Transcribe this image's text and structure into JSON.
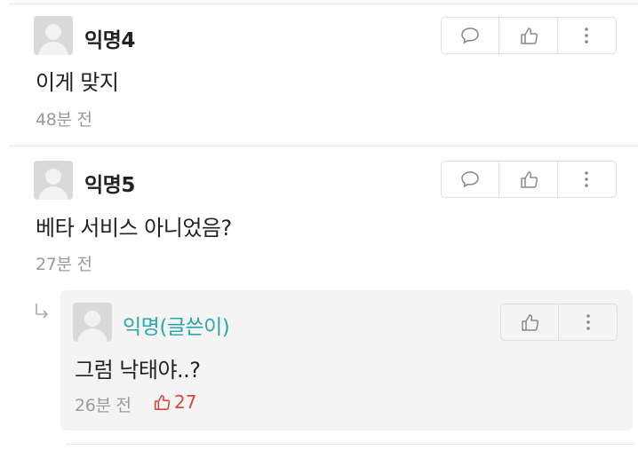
{
  "comments": [
    {
      "author": "익명4",
      "text": "이게 맞지",
      "time": "48분 전"
    },
    {
      "author": "익명5",
      "text": "베타 서비스 아니었음?",
      "time": "27분 전"
    }
  ],
  "reply": {
    "author": "익명(글쓴이)",
    "text": "그럼 낙태야..?",
    "time": "26분 전",
    "likes": "27"
  },
  "icons": [
    "comment-icon",
    "thumbs-up-icon",
    "more-vertical-icon",
    "reply-arrow-icon"
  ],
  "colors": {
    "op_author": "#2aa7a8",
    "like_count": "#d9463b",
    "reply_bg": "#f4f4f4"
  }
}
